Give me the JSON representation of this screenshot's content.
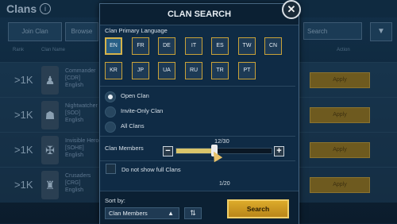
{
  "background": {
    "title": "Clans",
    "info_icon": "i",
    "buttons": [
      "Join Clan",
      "Browse"
    ],
    "search_placeholder": "Search",
    "filter_icon": "filter-icon",
    "col_rank": "Rank",
    "col_name": "Clan Name",
    "col_action": "Action",
    "rows": [
      {
        "rank": ">1K",
        "name": "Commander",
        "sub": "[CDR]",
        "lang": "English",
        "action": "Apply"
      },
      {
        "rank": ">1K",
        "name": "Nightwatcher",
        "sub": "[SOD]",
        "lang": "English",
        "action": "Apply"
      },
      {
        "rank": ">1K",
        "name": "Invisible Heroes",
        "sub": "[SOHE]",
        "lang": "English",
        "action": "Apply"
      },
      {
        "rank": ">1K",
        "name": "Crusaders",
        "sub": "[CRG]",
        "lang": "English",
        "action": "Apply"
      }
    ]
  },
  "modal": {
    "title": "CLAN SEARCH",
    "close_icon": "✕",
    "language_label": "Clan Primary Language",
    "languages": [
      "EN",
      "FR",
      "DE",
      "IT",
      "ES",
      "TW",
      "CN",
      "KR",
      "JP",
      "UA",
      "RU",
      "TR",
      "PT"
    ],
    "selected_language": "EN",
    "clan_types": [
      {
        "label": "Open Clan",
        "selected": true
      },
      {
        "label": "Invite-Only Clan",
        "selected": false
      },
      {
        "label": "All Clans",
        "selected": false
      }
    ],
    "members_label": "Clan Members",
    "members_value": "12/30",
    "members_current": 12,
    "members_max": 30,
    "minus": "−",
    "plus": "+",
    "hide_full_label": "Do not show full Clans",
    "peek_value": "1/20",
    "sort_label": "Sort by:",
    "sort_value": "Clan Members",
    "sort_arrow": "▲",
    "sort_order_icon": "sort-order-icon",
    "search_button": "Search"
  },
  "colors": {
    "accent_gold": "#d6b44a",
    "panel_bg": "#0f2b45"
  }
}
